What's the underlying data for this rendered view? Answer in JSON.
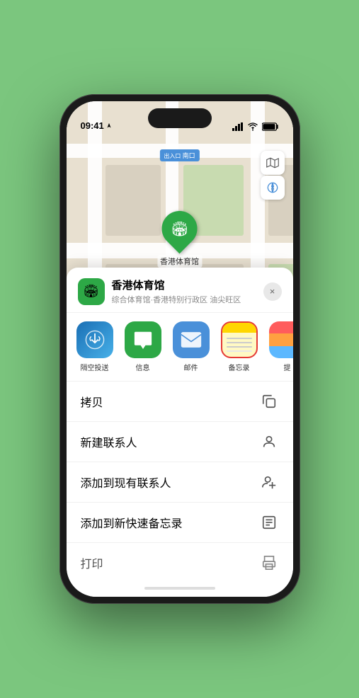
{
  "statusBar": {
    "time": "09:41",
    "locationIcon": "▶"
  },
  "mapLabel": "南口",
  "mapLabelPrefix": "出入口",
  "venueName": "香港体育馆",
  "venueSubtitle": "综合体育馆·香港特别行政区 油尖旺区",
  "closeButton": "×",
  "shareItems": [
    {
      "id": "airdrop",
      "label": "隔空投送",
      "type": "airdrop",
      "icon": "📡"
    },
    {
      "id": "message",
      "label": "信息",
      "type": "message",
      "icon": "💬"
    },
    {
      "id": "mail",
      "label": "邮件",
      "type": "mail",
      "icon": "✉️"
    },
    {
      "id": "notes",
      "label": "备忘录",
      "type": "notes",
      "icon": ""
    },
    {
      "id": "more",
      "label": "提",
      "type": "more",
      "icon": ""
    }
  ],
  "actionRows": [
    {
      "label": "拷贝",
      "iconType": "copy"
    },
    {
      "label": "新建联系人",
      "iconType": "contact-add"
    },
    {
      "label": "添加到现有联系人",
      "iconType": "contact-plus"
    },
    {
      "label": "添加到新快速备忘录",
      "iconType": "quick-note"
    },
    {
      "label": "打印",
      "iconType": "print"
    }
  ]
}
